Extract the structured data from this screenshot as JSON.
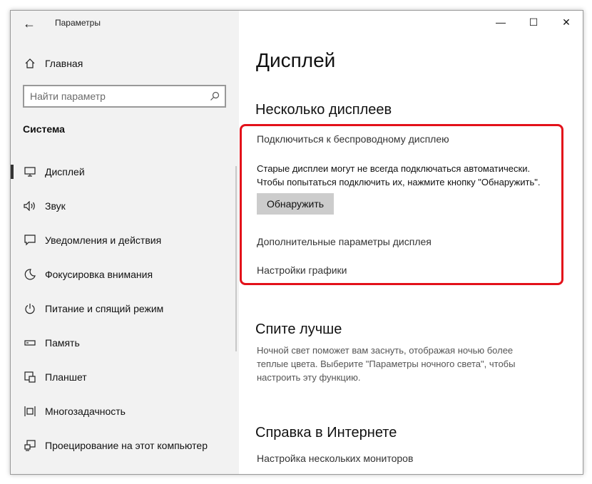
{
  "window": {
    "title": "Параметры"
  },
  "titlebar": {
    "minimize_glyph": "—",
    "maximize_glyph": "☐",
    "close_glyph": "✕",
    "back_glyph": "←"
  },
  "sidebar": {
    "home_label": "Главная",
    "search_placeholder": "Найти параметр",
    "section_title": "Система",
    "items": [
      {
        "label": "Дисплей",
        "icon": "monitor-icon",
        "active": true
      },
      {
        "label": "Звук",
        "icon": "speaker-icon"
      },
      {
        "label": "Уведомления и действия",
        "icon": "notification-icon"
      },
      {
        "label": "Фокусировка внимания",
        "icon": "moon-icon"
      },
      {
        "label": "Питание и спящий режим",
        "icon": "power-icon"
      },
      {
        "label": "Память",
        "icon": "storage-icon"
      },
      {
        "label": "Планшет",
        "icon": "tablet-icon"
      },
      {
        "label": "Многозадачность",
        "icon": "multitasking-icon"
      },
      {
        "label": "Проецирование на этот компьютер",
        "icon": "projecting-icon"
      }
    ]
  },
  "main": {
    "title": "Дисплей",
    "multiple_displays": {
      "heading": "Несколько дисплеев",
      "wireless_link": "Подключиться к беспроводному дисплею",
      "info_line1": "Старые дисплеи могут не всегда подключаться автоматически.",
      "info_line2": "Чтобы попытаться подключить их, нажмите кнопку \"Обнаружить\".",
      "detect_button": "Обнаружить",
      "advanced_link": "Дополнительные параметры дисплея",
      "graphics_link": "Настройки графики"
    },
    "sleep_better": {
      "heading": "Спите лучше",
      "description": "Ночной свет поможет вам заснуть, отображая ночью более теплые цвета. Выберите \"Параметры ночного света\", чтобы настроить эту функцию."
    },
    "help": {
      "heading": "Справка в Интернете",
      "link": "Настройка нескольких мониторов"
    }
  },
  "colors": {
    "highlight": "#e3111a",
    "sidebar_bg": "#f2f2f2",
    "button_bg": "#cccccc"
  }
}
